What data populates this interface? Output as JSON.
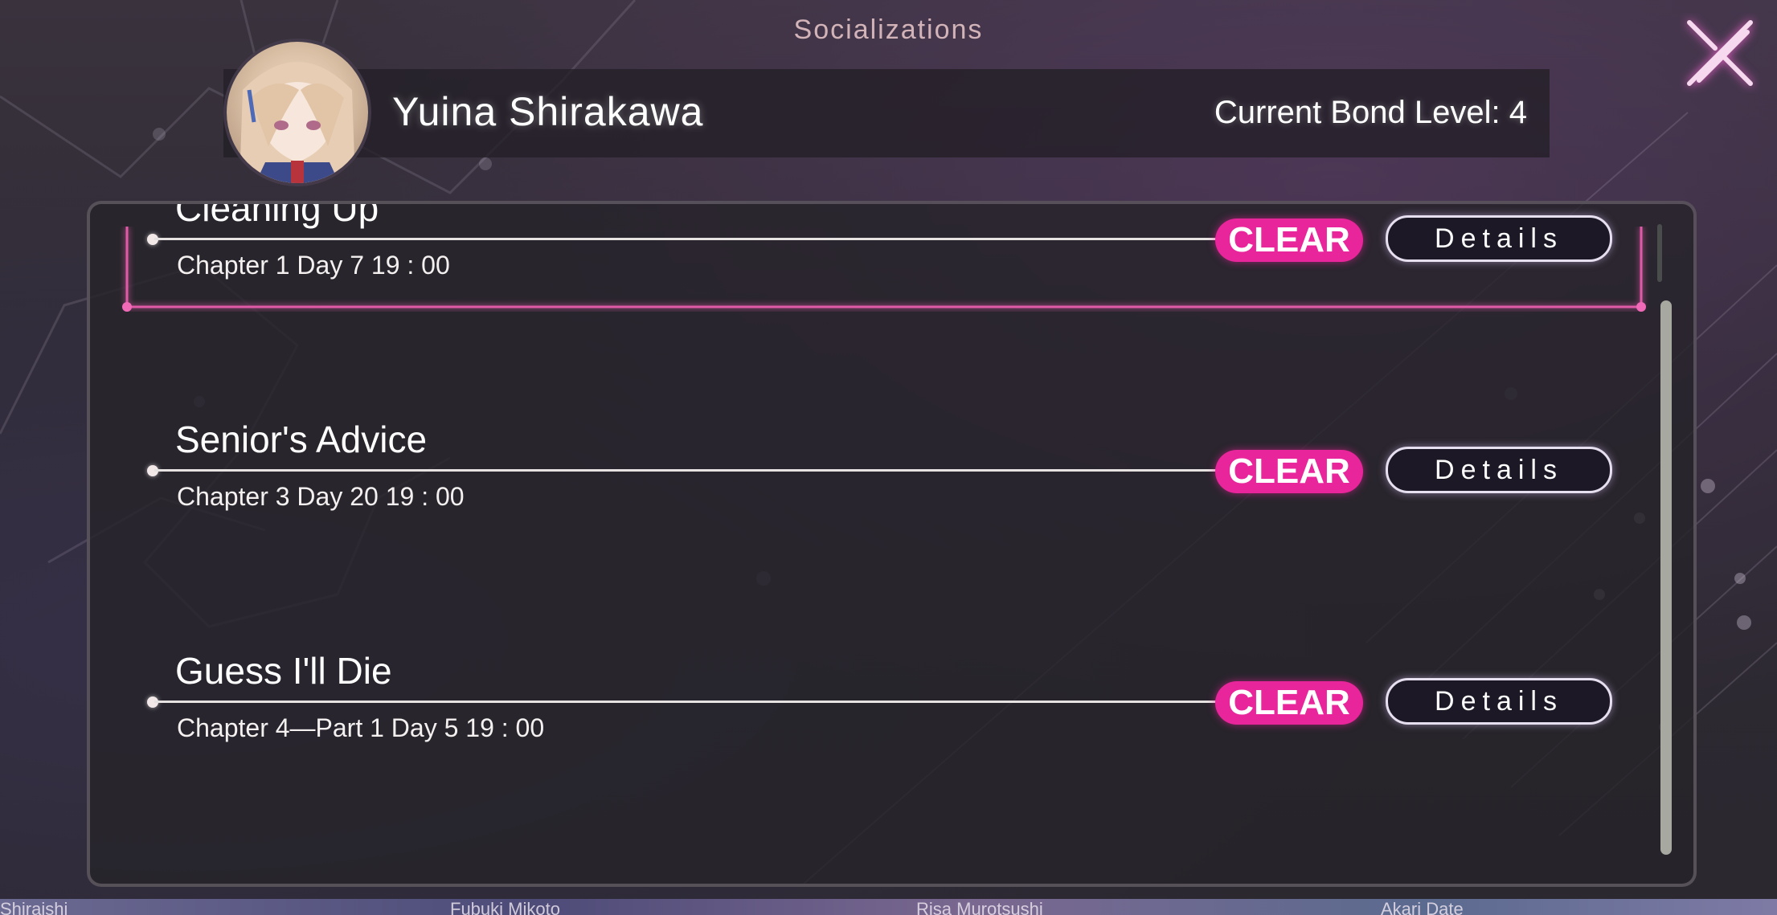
{
  "header": {
    "title": "Socializations",
    "close_icon": "close-x-icon"
  },
  "profile": {
    "name": "Yuina Shirakawa",
    "bond_level": "Current Bond Level: 4"
  },
  "events": [
    {
      "title": "Cleaning Up",
      "subtitle": "Chapter 1 Day 7 19 : 00",
      "badge": "CLEAR",
      "button": "Details"
    },
    {
      "title": "Senior's Advice",
      "subtitle": "Chapter 3 Day 20 19 : 00",
      "badge": "CLEAR",
      "button": "Details"
    },
    {
      "title": "Guess I'll Die",
      "subtitle": "Chapter 4—Part 1 Day 5 19 : 00",
      "badge": "CLEAR",
      "button": "Details"
    }
  ],
  "bottom_strip": {
    "names": [
      "Shiraishi",
      "Fubuki Mikoto",
      "Risa Murotsushi",
      "Akari Date"
    ]
  },
  "colors": {
    "accent": "#e8259a",
    "text": "#ffffff",
    "panel": "#26232a"
  }
}
